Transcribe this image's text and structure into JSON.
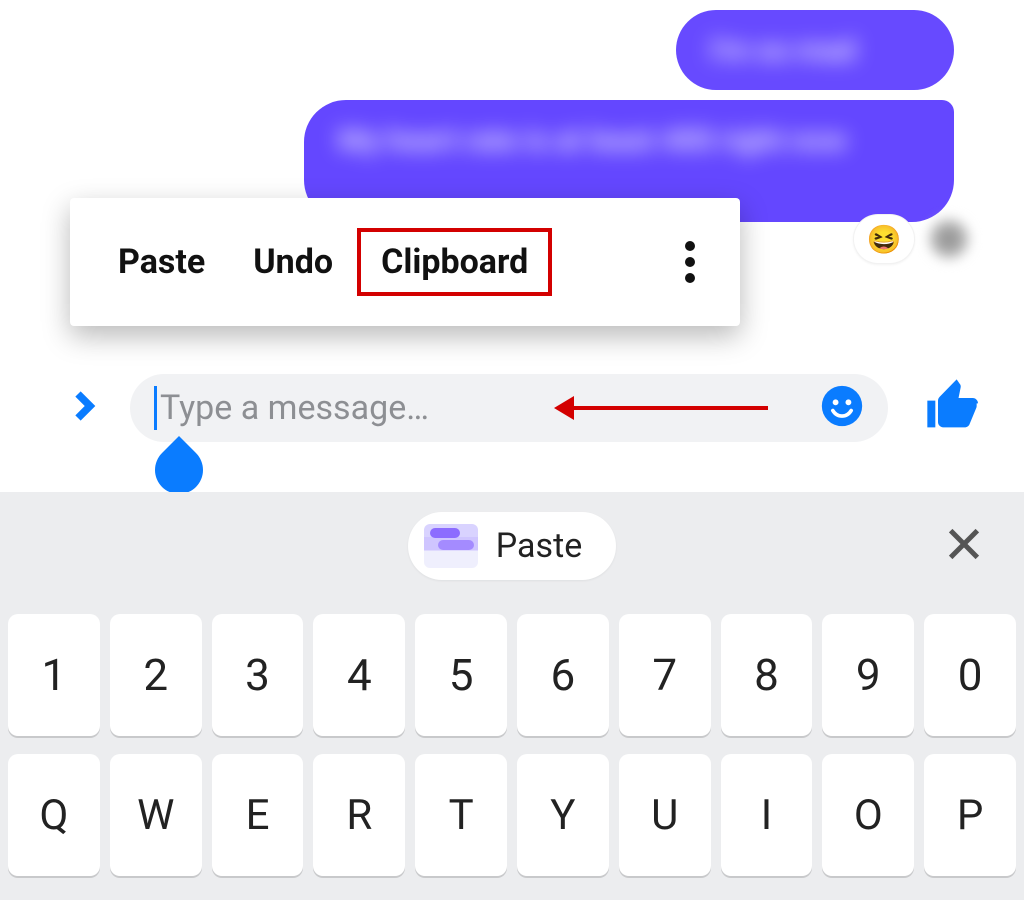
{
  "chat": {
    "bubbles": [
      {
        "role": "sent",
        "text_blurred": "I'm so mad"
      },
      {
        "role": "sent",
        "text_blurred": "My heart rate is at least 400 right now"
      }
    ],
    "reaction_emoji": "😆"
  },
  "context_menu": {
    "items": [
      "Paste",
      "Undo",
      "Clipboard"
    ],
    "highlighted_index": 2,
    "more_icon": "more-vertical-icon"
  },
  "input": {
    "placeholder": "Type a message…",
    "value": "",
    "expand_icon": "chevron-right-icon",
    "emoji_icon": "smiley-icon",
    "send_icon": "thumbs-up-icon"
  },
  "annotation": {
    "arrow_color": "#d30000",
    "highlight_box_color": "#d30000"
  },
  "keyboard_strip": {
    "chip_label": "Paste",
    "chip_icon": "clipboard-preview-icon",
    "close_icon": "close-icon"
  },
  "keyboard": {
    "row_numbers": [
      "1",
      "2",
      "3",
      "4",
      "5",
      "6",
      "7",
      "8",
      "9",
      "0"
    ],
    "row_letters": [
      "Q",
      "W",
      "E",
      "R",
      "T",
      "Y",
      "U",
      "I",
      "O",
      "P"
    ]
  },
  "colors": {
    "accent_blue": "#0a7cff",
    "bubble_purple": "#6447ff",
    "keyboard_bg": "#ecedef",
    "annotation_red": "#d30000"
  }
}
